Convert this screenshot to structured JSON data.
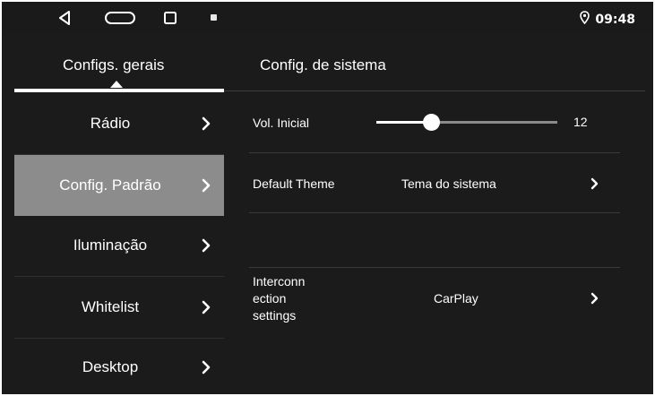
{
  "status_bar": {
    "time": "09:48",
    "icons": [
      "back-icon",
      "home-icon",
      "recents-icon",
      "notification-icon",
      "location-icon"
    ]
  },
  "tabs": [
    {
      "label": "Configs. gerais",
      "active": true
    },
    {
      "label": "Config. de sistema",
      "active": false
    }
  ],
  "sidebar": {
    "items": [
      {
        "label": "Rádio",
        "active": false
      },
      {
        "label": "Config. Padrão",
        "active": true
      },
      {
        "label": "Iluminação",
        "active": false
      },
      {
        "label": "Whitelist",
        "active": false
      },
      {
        "label": "Desktop",
        "active": false
      }
    ]
  },
  "settings": {
    "volume": {
      "label": "Vol. Inicial",
      "value": "12",
      "level_fraction": 0.3
    },
    "theme": {
      "label": "Default Theme",
      "value": "Tema do sistema"
    },
    "interconnection": {
      "label_lines": [
        "Interconn",
        "ection",
        "settings"
      ],
      "value": "CarPlay"
    }
  },
  "colors": {
    "background": "#1b1b1b",
    "active_item": "#8c8c8c",
    "text": "#ffffff"
  }
}
